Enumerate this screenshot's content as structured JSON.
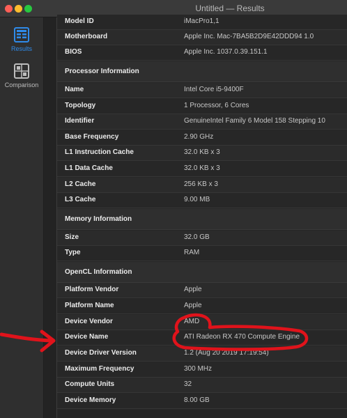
{
  "window": {
    "title": "Untitled — Results"
  },
  "sidebar": {
    "items": [
      {
        "label": "Results",
        "icon": "results-icon",
        "active": true
      },
      {
        "label": "Comparison",
        "icon": "comparison-icon",
        "active": false
      }
    ]
  },
  "rows_top": [
    {
      "key": "Model ID",
      "value": "iMacPro1,1"
    },
    {
      "key": "Motherboard",
      "value": "Apple Inc. Mac-7BA5B2D9E42DDD94 1.0"
    },
    {
      "key": "BIOS",
      "value": "Apple Inc. 1037.0.39.151.1"
    }
  ],
  "sections": {
    "processor": "Processor Information",
    "memory": "Memory Information",
    "opencl": "OpenCL Information"
  },
  "processor_rows": [
    {
      "key": "Name",
      "value": "Intel Core i5-9400F"
    },
    {
      "key": "Topology",
      "value": "1 Processor, 6 Cores"
    },
    {
      "key": "Identifier",
      "value": "GenuineIntel Family 6 Model 158 Stepping 10"
    },
    {
      "key": "Base Frequency",
      "value": "2.90 GHz"
    },
    {
      "key": "L1 Instruction Cache",
      "value": "32.0 KB x 3"
    },
    {
      "key": "L1 Data Cache",
      "value": "32.0 KB x 3"
    },
    {
      "key": "L2 Cache",
      "value": "256 KB x 3"
    },
    {
      "key": "L3 Cache",
      "value": "9.00 MB"
    }
  ],
  "memory_rows": [
    {
      "key": "Size",
      "value": "32.0 GB"
    },
    {
      "key": "Type",
      "value": "RAM"
    }
  ],
  "opencl_rows": [
    {
      "key": "Platform Vendor",
      "value": "Apple"
    },
    {
      "key": "Platform Name",
      "value": "Apple"
    },
    {
      "key": "Device Vendor",
      "value": "AMD"
    },
    {
      "key": "Device Name",
      "value": "ATI Radeon RX 470 Compute Engine"
    },
    {
      "key": "Device Driver Version",
      "value": "1.2 (Aug 20 2019 17:19:54)"
    },
    {
      "key": "Maximum Frequency",
      "value": "300 MHz"
    },
    {
      "key": "Compute Units",
      "value": "32"
    },
    {
      "key": "Device Memory",
      "value": "8.00 GB"
    }
  ],
  "colors": {
    "accent": "#2f8bea",
    "annotation": "#e0131b"
  }
}
